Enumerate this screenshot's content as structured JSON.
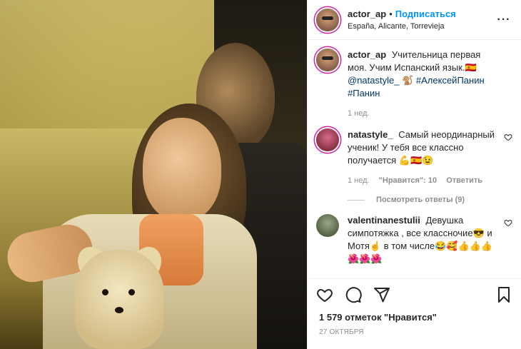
{
  "header": {
    "username": "actor_ap",
    "separator": "•",
    "follow_label": "Подписаться",
    "location": "España, Alicante, Torrevieja"
  },
  "caption": {
    "username": "actor_ap",
    "text_line1": "Учительница первая моя. Учим Испанский язык.🇪🇸",
    "mention": "@natastyle_",
    "emoji": "🐒",
    "tag1": "#АлексейПанин",
    "tag2": "#Панин",
    "time": "1 нед."
  },
  "comments": [
    {
      "username": "natastyle_",
      "text": "Самый неординарный ученик! У тебя все классно получается 💪🇪🇸😉",
      "time": "1 нед.",
      "likes": "\"Нравится\": 10",
      "reply": "Ответить",
      "view_replies": "Посмотреть ответы (9)"
    },
    {
      "username": "valentinanestulii",
      "text": "Девушка симпотяжка , все классночие😎 и Мотя☝ в том числе😂🥰👍👍👍🌺🌺🌺"
    }
  ],
  "actions": {
    "like_icon": "heart-icon",
    "comment_icon": "comment-icon",
    "share_icon": "share-icon",
    "save_icon": "bookmark-icon"
  },
  "likes_text": "1 579 отметок \"Нравится\"",
  "date_text": "27 ОКТЯБРЯ",
  "colors": {
    "accent": "#0095f6",
    "text": "#262626",
    "muted": "#8e8e8e",
    "story_ring": "#d6249f"
  }
}
